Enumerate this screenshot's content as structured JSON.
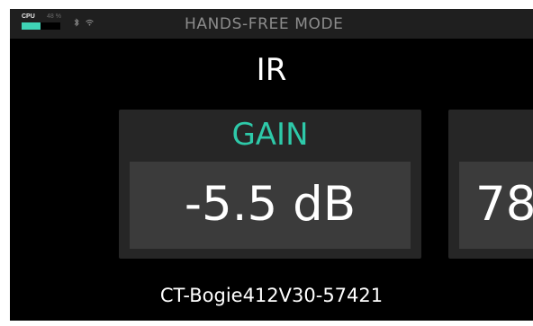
{
  "status_bar": {
    "cpu_label": "CPU",
    "cpu_percent_text": "48 %",
    "cpu_level": 0.48,
    "bluetooth_icon": "bluetooth-icon",
    "wifi_icon": "wifi-icon",
    "mode_title": "HANDS-FREE MODE"
  },
  "block": {
    "name": "IR"
  },
  "parameters": [
    {
      "label": "GAIN",
      "value": "-5.5 dB"
    },
    {
      "label": "",
      "value": "78"
    }
  ],
  "ir_file": {
    "name": "CT-Bogie412V30-57421"
  },
  "colors": {
    "accent": "#2ec9a9",
    "cpu_fill": "#3fd3b5",
    "background": "#000000",
    "card": "#262626",
    "value_box": "#3b3b3b"
  }
}
